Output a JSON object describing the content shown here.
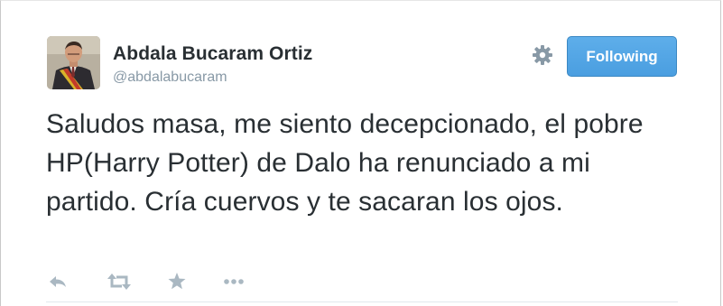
{
  "user": {
    "display_name": "Abdala Bucaram Ortiz",
    "handle": "@abdalabucaram"
  },
  "follow_button": {
    "label": "Following",
    "color": "#4a9ee0"
  },
  "tweet": {
    "text": "Saludos masa, me siento decepcionado, el pobre HP(Harry Potter) de Dalo ha renunciado a mi partido. Cría cuervos y te sacaran los ojos."
  },
  "icons": {
    "settings": "gear-icon",
    "reply": "reply-icon",
    "retweet": "retweet-icon",
    "favorite": "star-icon",
    "more": "more-icon"
  },
  "colors": {
    "name": "#292f33",
    "handle": "#8899a6",
    "icon": "#aab8c2"
  }
}
